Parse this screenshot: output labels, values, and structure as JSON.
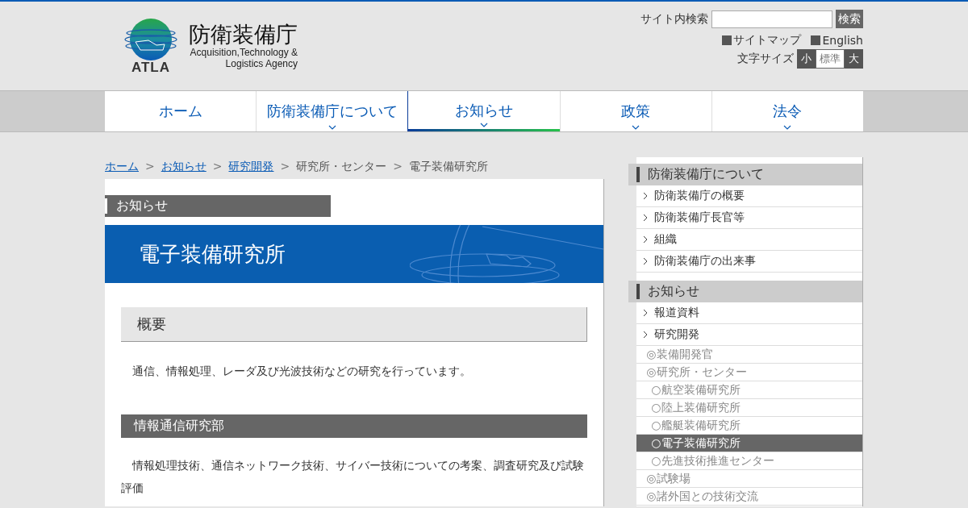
{
  "header": {
    "logo": {
      "name": "防衛装備庁",
      "english_1": "Acquisition,Technology &",
      "english_2": "Logistics Agency",
      "abbr": "ATLA"
    },
    "search": {
      "label": "サイト内検索",
      "button": "検索"
    },
    "links": [
      {
        "label": "サイトマップ"
      },
      {
        "label": "English"
      }
    ],
    "font_size": {
      "label": "文字サイズ",
      "options": [
        {
          "label": "小",
          "selected": false
        },
        {
          "label": "標準",
          "selected": true
        },
        {
          "label": "大",
          "selected": false
        }
      ]
    }
  },
  "nav": [
    {
      "label": "ホーム",
      "selected": false,
      "has_submenu": false
    },
    {
      "label": "防衛装備庁について",
      "selected": false,
      "has_submenu": true
    },
    {
      "label": "お知らせ",
      "selected": true,
      "has_submenu": true
    },
    {
      "label": "政策",
      "selected": false,
      "has_submenu": true
    },
    {
      "label": "法令",
      "selected": false,
      "has_submenu": true
    }
  ],
  "breadcrumb": [
    {
      "label": "ホーム",
      "kind": "link"
    },
    {
      "label": ">",
      "kind": "separator"
    },
    {
      "label": "お知らせ",
      "kind": "link"
    },
    {
      "label": ">",
      "kind": "separator"
    },
    {
      "label": "研究開発",
      "kind": "link"
    },
    {
      "label": ">",
      "kind": "separator"
    },
    {
      "label": "研究所・センター",
      "kind": "text"
    },
    {
      "label": ">",
      "kind": "separator"
    },
    {
      "label": "電子装備研究所",
      "kind": "text"
    }
  ],
  "category": "お知らせ",
  "page_title": "電子装備研究所",
  "sections": [
    {
      "kind": "light",
      "heading": "概要",
      "body": "通信、情報処理、レーダ及び光波技術などの研究を行っています。"
    },
    {
      "kind": "dark",
      "heading": "情報通信研究部",
      "body": "情報処理技術、通信ネットワーク技術、サイバー技術についての考案、調査研究及び試験評価"
    }
  ],
  "sidebar": [
    {
      "title": "防衛装備庁について",
      "items": [
        {
          "label": "防衛装備庁の概要",
          "kind": "arrow",
          "selected": false
        },
        {
          "label": "防衛装備庁長官等",
          "kind": "arrow",
          "selected": false
        },
        {
          "label": "組織",
          "kind": "arrow",
          "selected": false
        },
        {
          "label": "防衛装備庁の出来事",
          "kind": "arrow",
          "selected": false
        }
      ]
    },
    {
      "title": "お知らせ",
      "items": [
        {
          "label": "報道資料",
          "kind": "arrow",
          "selected": false
        },
        {
          "label": "研究開発",
          "kind": "arrow",
          "selected": false
        },
        {
          "label": "◎装備開発官",
          "kind": "sub",
          "selected": false
        },
        {
          "label": "◎研究所・センター",
          "kind": "sub",
          "selected": false
        },
        {
          "label": "○航空装備研究所",
          "kind": "subsub",
          "selected": false
        },
        {
          "label": "○陸上装備研究所",
          "kind": "subsub",
          "selected": false
        },
        {
          "label": "○艦艇装備研究所",
          "kind": "subsub",
          "selected": false
        },
        {
          "label": "○電子装備研究所",
          "kind": "subsub",
          "selected": true
        },
        {
          "label": "○先進技術推進センター",
          "kind": "subsub",
          "selected": false
        },
        {
          "label": "◎試験場",
          "kind": "sub",
          "selected": false
        },
        {
          "label": "◎諸外国との技術交流",
          "kind": "sub",
          "selected": false
        }
      ]
    }
  ]
}
